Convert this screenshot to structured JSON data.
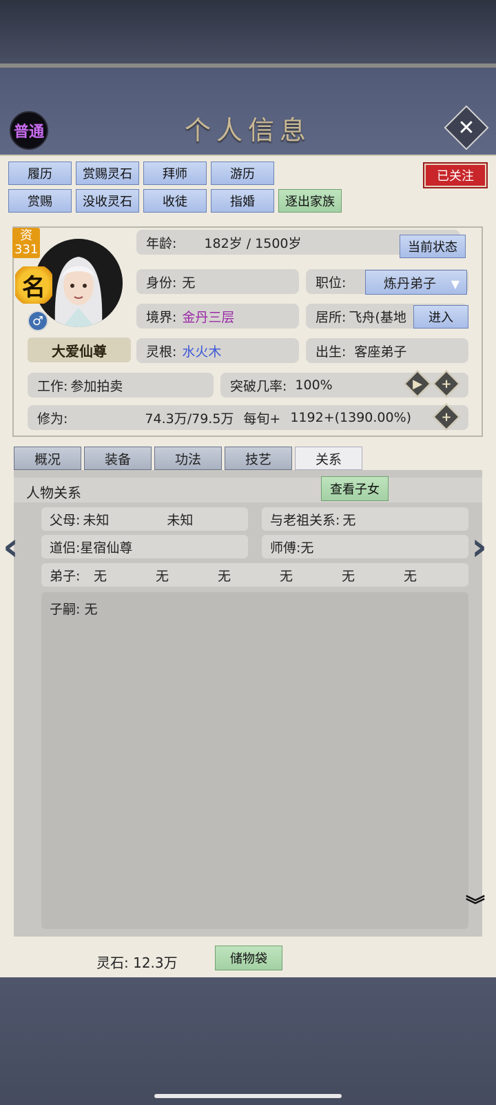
{
  "header": {
    "rank_badge": "普通",
    "title": "个人信息"
  },
  "actions_row1": [
    "履历",
    "赏赐灵石",
    "拜师",
    "游历"
  ],
  "actions_row2": [
    "赏赐",
    "没收灵石",
    "收徒",
    "指婚"
  ],
  "expel_label": "逐出家族",
  "followed_label": "已关注",
  "portrait": {
    "zi_label": "资",
    "zi_value": "331",
    "ming": "名",
    "gender": "♂",
    "name": "大爱仙尊"
  },
  "info": {
    "age_label": "年龄:",
    "age_value": "182岁 / 1500岁",
    "status_button": "当前状态",
    "identity_label": "身份:",
    "identity_value": "无",
    "position_label": "职位:",
    "position_value": "炼丹弟子",
    "realm_label": "境界:",
    "realm_value": "金丹三层",
    "residence_label": "居所:",
    "residence_value": "飞舟(基地",
    "enter_button": "进入",
    "root_label": "灵根:",
    "root_value": "水火木",
    "birth_label": "出生:",
    "birth_value": "客座弟子",
    "work_label": "工作:",
    "work_value": "参加拍卖",
    "breakthrough_label": "突破几率:",
    "breakthrough_value": "100%",
    "cultivation_label": "修为:",
    "cultivation_value": "74.3万/79.5万",
    "per_turn_label": "每旬+",
    "per_turn_value": "1192+(1390.00%)"
  },
  "tabs": [
    "概况",
    "装备",
    "功法",
    "技艺",
    "关系"
  ],
  "relations": {
    "title": "人物关系",
    "view_children_button": "查看子女",
    "parents_label": "父母:",
    "parent1": "未知",
    "parent2": "未知",
    "ancestor_label": "与老祖关系:",
    "ancestor_value": "无",
    "partner_label": "道侣:",
    "partner_value": "星宿仙尊",
    "master_label": "师傅:",
    "master_value": "无",
    "disciples_label": "弟子:",
    "disciples": [
      "无",
      "无",
      "无",
      "无",
      "无",
      "无"
    ],
    "heirs_label": "子嗣:",
    "heirs_value": "无"
  },
  "footer": {
    "spirit_stone_label": "灵石:",
    "spirit_stone_value": "12.3万",
    "storage_button": "储物袋"
  }
}
